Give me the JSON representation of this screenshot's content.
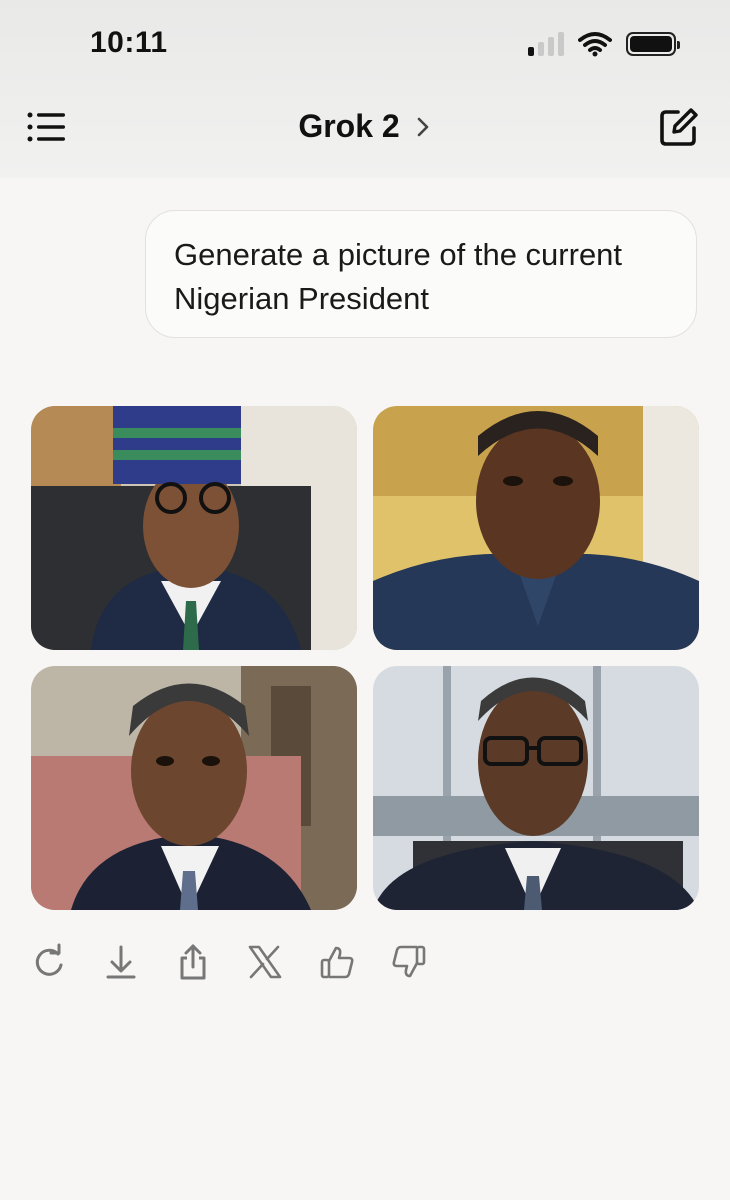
{
  "status_bar": {
    "time": "10:11",
    "icons": [
      "signal-icon",
      "wifi-icon",
      "battery-icon"
    ]
  },
  "header": {
    "title": "Grok 2",
    "menu_icon": "list-menu-icon",
    "new_chat_icon": "edit-icon"
  },
  "message": {
    "user_text": "Generate a picture of the current Nigerian President"
  },
  "images": [
    {
      "name": "generated-image-1"
    },
    {
      "name": "generated-image-2"
    },
    {
      "name": "generated-image-3"
    },
    {
      "name": "generated-image-4"
    }
  ],
  "actions": [
    "regenerate-icon",
    "download-icon",
    "share-icon",
    "x-share-icon",
    "thumbs-up-icon",
    "thumbs-down-icon"
  ],
  "colors": {
    "background": "#f7f6f5",
    "bubble": "#fbfbfa",
    "icon": "#777777"
  }
}
